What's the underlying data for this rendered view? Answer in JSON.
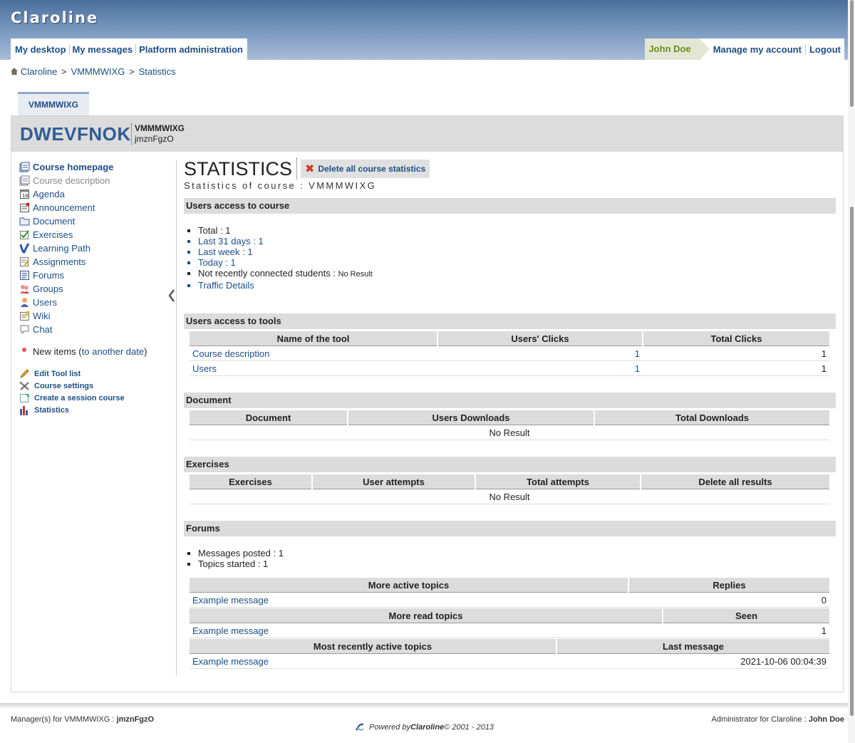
{
  "app": {
    "logo": "Claroline"
  },
  "nav": {
    "left": [
      "My desktop",
      "My messages",
      "Platform administration"
    ],
    "user": "John Doe",
    "manage_account": "Manage my account",
    "logout": "Logout"
  },
  "breadcrumb": [
    "Claroline",
    "VMMMWIXG",
    "Statistics"
  ],
  "course": {
    "tab": "VMMMWIXG",
    "title": "DWEVFNOK",
    "code": "VMMMWIXG",
    "sub": "jmznFgzO"
  },
  "sidebar": {
    "tools": [
      {
        "label": "Course homepage",
        "icon": "course-homepage-icon"
      },
      {
        "label": "Course description",
        "icon": "course-description-icon"
      },
      {
        "label": "Agenda",
        "icon": "agenda-icon"
      },
      {
        "label": "Announcement",
        "icon": "announcement-icon"
      },
      {
        "label": "Document",
        "icon": "document-icon"
      },
      {
        "label": "Exercises",
        "icon": "exercises-icon"
      },
      {
        "label": "Learning Path",
        "icon": "learning-path-icon"
      },
      {
        "label": "Assignments",
        "icon": "assignments-icon"
      },
      {
        "label": "Forums",
        "icon": "forums-icon"
      },
      {
        "label": "Groups",
        "icon": "groups-icon"
      },
      {
        "label": "Users",
        "icon": "users-icon"
      },
      {
        "label": "Wiki",
        "icon": "wiki-icon"
      },
      {
        "label": "Chat",
        "icon": "chat-icon"
      }
    ],
    "new_items": "New items",
    "new_items_link": "to another date",
    "manage": [
      {
        "label": "Edit Tool list",
        "icon": "pencil-icon"
      },
      {
        "label": "Course settings",
        "icon": "tools-icon"
      },
      {
        "label": "Create a session course",
        "icon": "session-icon"
      },
      {
        "label": "Statistics",
        "icon": "statistics-icon"
      }
    ]
  },
  "main": {
    "title": "STATISTICS",
    "delete_label": "Delete all course statistics",
    "subtitle": "Statistics of course : VMMMWIXG",
    "access": {
      "heading": "Users access to course",
      "total": "Total : 1",
      "last31": "Last 31 days : 1",
      "lastweek": "Last week : 1",
      "today": "Today : 1",
      "not_connected": "Not recently connected students : ",
      "not_connected_value": "No Result",
      "traffic": "Traffic Details"
    },
    "tools": {
      "heading": "Users access to tools",
      "columns": [
        "Name of the tool",
        "Users' Clicks",
        "Total Clicks"
      ],
      "rows": [
        {
          "name": "Course description",
          "users": "1",
          "total": "1"
        },
        {
          "name": "Users",
          "users": "1",
          "total": "1"
        }
      ]
    },
    "document": {
      "heading": "Document",
      "columns": [
        "Document",
        "Users Downloads",
        "Total Downloads"
      ],
      "empty": "No Result"
    },
    "exercises": {
      "heading": "Exercises",
      "columns": [
        "Exercises",
        "User attempts",
        "Total attempts",
        "Delete all results"
      ],
      "empty": "No Result"
    },
    "forums": {
      "heading": "Forums",
      "messages": "Messages posted : 1",
      "topics": "Topics started : 1",
      "active": {
        "columns": [
          "More active topics",
          "Replies"
        ],
        "row": {
          "topic": "Example message",
          "value": "0"
        }
      },
      "read": {
        "columns": [
          "More read topics",
          "Seen"
        ],
        "row": {
          "topic": "Example message",
          "value": "1"
        }
      },
      "recent": {
        "columns": [
          "Most recently active topics",
          "Last message"
        ],
        "row": {
          "topic": "Example message",
          "value": "2021-10-06 00:04:39"
        }
      }
    }
  },
  "footer": {
    "managers_prefix": "Manager(s) for VMMMWIXG : ",
    "managers_name": "jmznFgzO",
    "admin_prefix": "Administrator for Claroline : ",
    "admin_name": "John Doe",
    "powered_prefix": "Powered by ",
    "powered_brand": "Claroline",
    "powered_suffix": " © 2001 - 2013"
  }
}
